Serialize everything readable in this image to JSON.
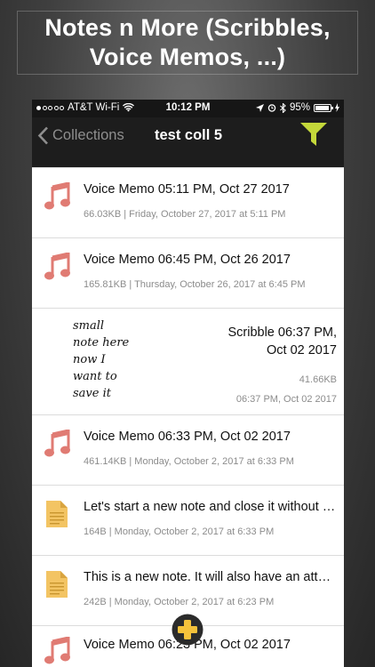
{
  "promo": {
    "line1": "Notes n More (Scribbles,",
    "line2": "Voice Memos, ...)"
  },
  "status_bar": {
    "carrier": "AT&T Wi-Fi",
    "time": "10:12 PM",
    "battery": "95%",
    "battery_level": 0.95
  },
  "nav": {
    "back_label": "Collections",
    "title": "test coll 5"
  },
  "items": [
    {
      "type": "voice",
      "title": "Voice Memo 05:11 PM, Oct 27 2017",
      "meta": "66.03KB | Friday, October 27, 2017 at 5:11 PM"
    },
    {
      "type": "voice",
      "title": "Voice Memo 06:45 PM, Oct 26 2017",
      "meta": "165.81KB | Thursday, October 26, 2017 at 6:45 PM"
    },
    {
      "type": "scribble",
      "title_line1": "Scribble 06:37 PM,",
      "title_line2": "Oct 02 2017",
      "size": "41.66KB",
      "time": "06:37 PM, Oct 02 2017",
      "handwriting": [
        "small",
        "note here",
        "now I",
        "want to",
        "save it"
      ]
    },
    {
      "type": "voice",
      "title": "Voice Memo 06:33 PM, Oct 02 2017",
      "meta": "461.14KB | Monday, October 2, 2017 at 6:33 PM"
    },
    {
      "type": "note",
      "title": "Let's start a new note and close it without saving",
      "meta": "164B | Monday, October 2, 2017 at 6:33 PM"
    },
    {
      "type": "note",
      "title": "This is a new note. It will also have an attachment",
      "meta": "242B | Monday, October 2, 2017 at 6:23 PM"
    },
    {
      "type": "voice",
      "title": "Voice Memo 06:23 PM, Oct 02 2017",
      "meta": ""
    }
  ],
  "colors": {
    "music_icon": "#e07b73",
    "filter_icon": "#c4d83a",
    "note_icon": "#f3c463",
    "add_button": "#f5c23b"
  }
}
